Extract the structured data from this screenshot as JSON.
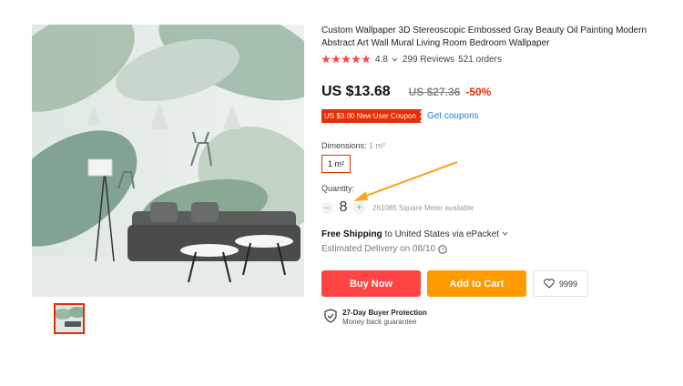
{
  "product": {
    "title": "Custom Wallpaper 3D Stereoscopic Embossed Gray Beauty Oil Painting Modern Abstract Art Wall Mural Living Room Bedroom Wallpaper",
    "rating": "4.8",
    "reviews": "299 Reviews",
    "orders": "521 orders",
    "stars": 5,
    "price": "US $13.68",
    "old_price": "US $27.36",
    "discount": "-50%",
    "coupon": "US $3.00 New User Coupon",
    "get_coupons": "Get coupons",
    "dimensions_label": "Dimensions:",
    "dimensions_value": "1 m²",
    "dimension_option": "1 m²",
    "quantity_label": "Quantity:",
    "quantity_minus": "–",
    "quantity": "8",
    "quantity_plus": "+",
    "available": "261085 Square Meter available",
    "shipping_bold": "Free Shipping",
    "shipping_rest": " to United States via ePacket",
    "delivery": "Estimated Delivery on 08/10",
    "buy_now": "Buy Now",
    "add_to_cart": "Add to Cart",
    "wishlist_count": "9999",
    "protection_title": "27-Day Buyer Protection",
    "protection_sub": "Money back guarantee"
  },
  "colors": {
    "accent_red": "#e62e04",
    "buy_button": "#ff4444",
    "cart_button": "#ff9a00",
    "link_blue": "#1a7fd6",
    "arrow_orange": "#f5a623"
  }
}
